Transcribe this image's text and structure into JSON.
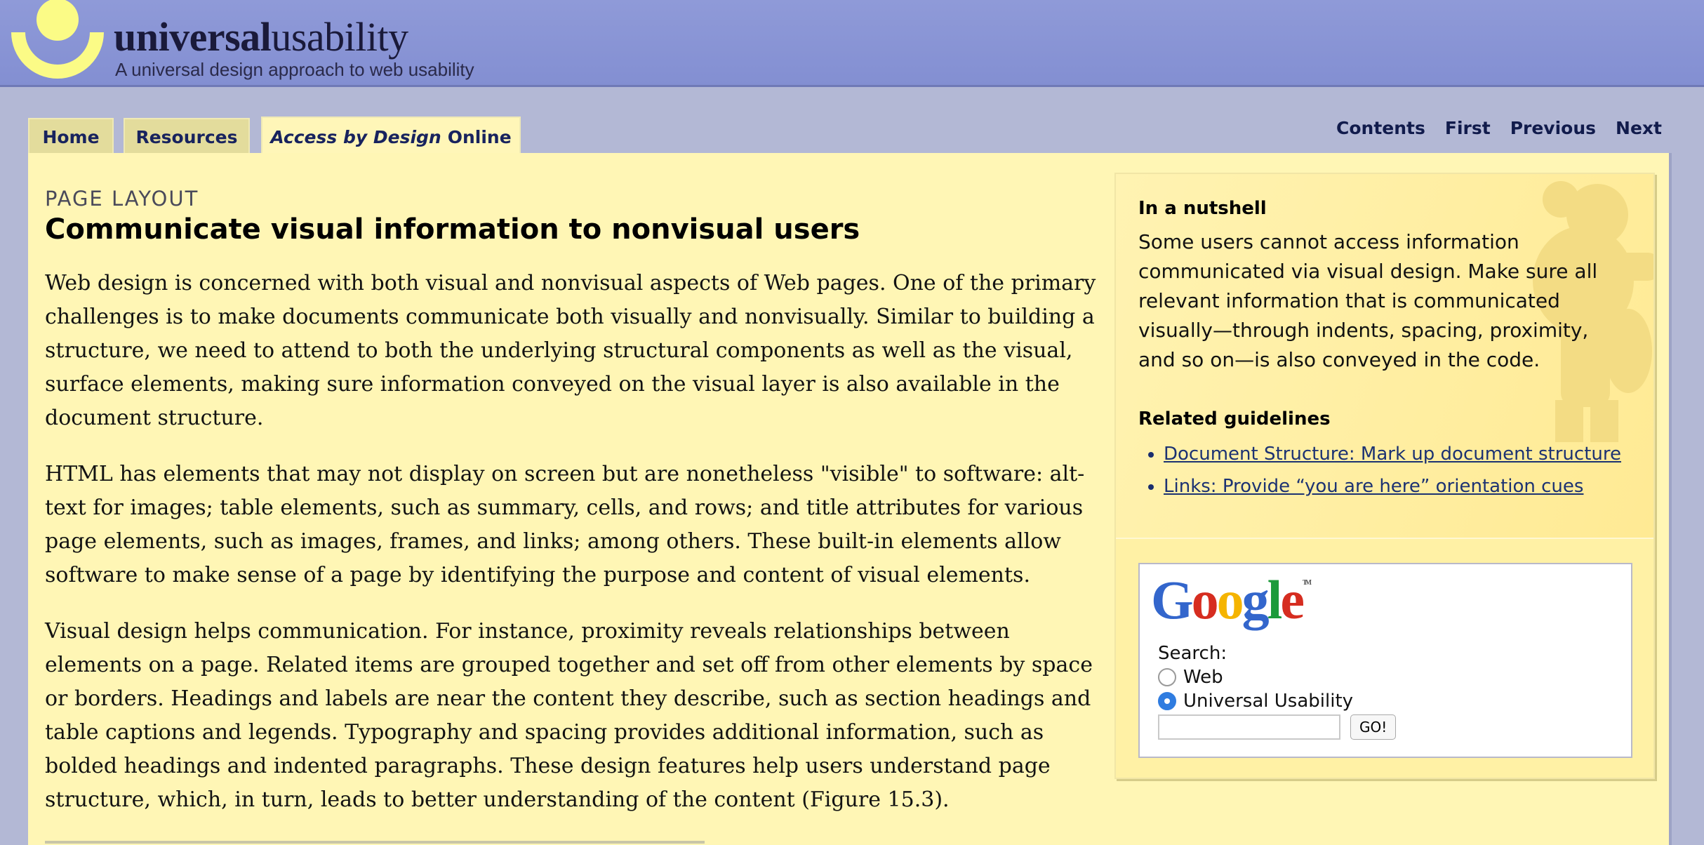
{
  "header": {
    "brand_bold": "universal",
    "brand_light": "usability",
    "tagline": "A universal design approach to web usability"
  },
  "tabs": [
    {
      "label": "Home"
    },
    {
      "label": "Resources"
    },
    {
      "label_em": "Access by Design",
      "label_rest": "Online"
    }
  ],
  "top_nav": [
    "Contents",
    "First",
    "Previous",
    "Next"
  ],
  "main": {
    "kicker": "PAGE LAYOUT",
    "title": "Communicate visual information to nonvisual users",
    "paragraphs": [
      "Web design is concerned with both visual and nonvisual aspects of Web pages. One of the primary challenges is to make documents communicate both visually and nonvisually. Similar to building a structure, we need to attend to both the underlying structural components as well as the visual, surface elements, making sure information conveyed on the visual layer is also available in the document structure.",
      "HTML has elements that may not display on screen but are nonetheless \"visible\" to software: alt-text for images; table elements, such as summary, cells, and rows; and title attributes for various page elements, such as images, frames, and links; among others. These built-in elements allow software to make sense of a page by identifying the purpose and content of visual elements.",
      "Visual design helps communication. For instance, proximity reveals relationships between elements on a page. Related items are grouped together and set off from other elements by space or borders. Headings and labels are near the content they describe, such as section headings and table captions and legends. Typography and spacing provides additional information, such as bolded headings and indented paragraphs. These design features help users understand page structure, which, in turn, leads to better understanding of the content (Figure 15.3)."
    ]
  },
  "sidebar": {
    "nutshell_heading": "In a nutshell",
    "nutshell_text": "Some users cannot access information communicated via visual design. Make sure all relevant information that is communicated visually—through indents, spacing, proximity, and so on—is also conveyed in the code.",
    "related_heading": "Related guidelines",
    "related_links": [
      "Document Structure: Mark up document structure",
      "Links: Provide “you are here” orientation cues"
    ],
    "google": {
      "logo_letters": [
        "G",
        "o",
        "o",
        "g",
        "l",
        "e"
      ],
      "trademark": "TM",
      "search_label": "Search:",
      "options": [
        {
          "label": "Web",
          "checked": false
        },
        {
          "label": "Universal Usability",
          "checked": true
        }
      ],
      "input_value": "",
      "button_label": "GO!"
    }
  },
  "colors": {
    "header_bg": "#8a95d5",
    "page_bg": "#b3b8d5",
    "panel_bg": "#fff6b5",
    "tab_bg": "#e3dc9c",
    "logo_yellow": "#fbfb86",
    "link": "#1c3272",
    "google": [
      "#3366cc",
      "#d62d20",
      "#f5b400",
      "#3366cc",
      "#1c9a3a",
      "#d62d20"
    ]
  }
}
